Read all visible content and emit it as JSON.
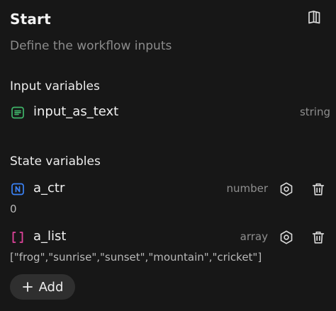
{
  "header": {
    "title": "Start",
    "subtitle": "Define the workflow inputs",
    "docs_icon": "book-open-icon"
  },
  "input_section": {
    "title": "Input variables",
    "items": [
      {
        "name": "input_as_text",
        "type": "string",
        "icon": "text-lines-icon",
        "icon_color": "#3fb469"
      }
    ]
  },
  "state_section": {
    "title": "State variables",
    "items": [
      {
        "name": "a_ctr",
        "type": "number",
        "icon": "number-n-icon",
        "icon_color": "#3b82f6",
        "value": "0"
      },
      {
        "name": "a_list",
        "type": "array",
        "icon": "brackets-icon",
        "icon_color": "#e0449b",
        "value": "[\"frog\",\"sunrise\",\"sunset\",\"mountain\",\"cricket\"]"
      }
    ]
  },
  "add_button": {
    "label": "Add"
  }
}
